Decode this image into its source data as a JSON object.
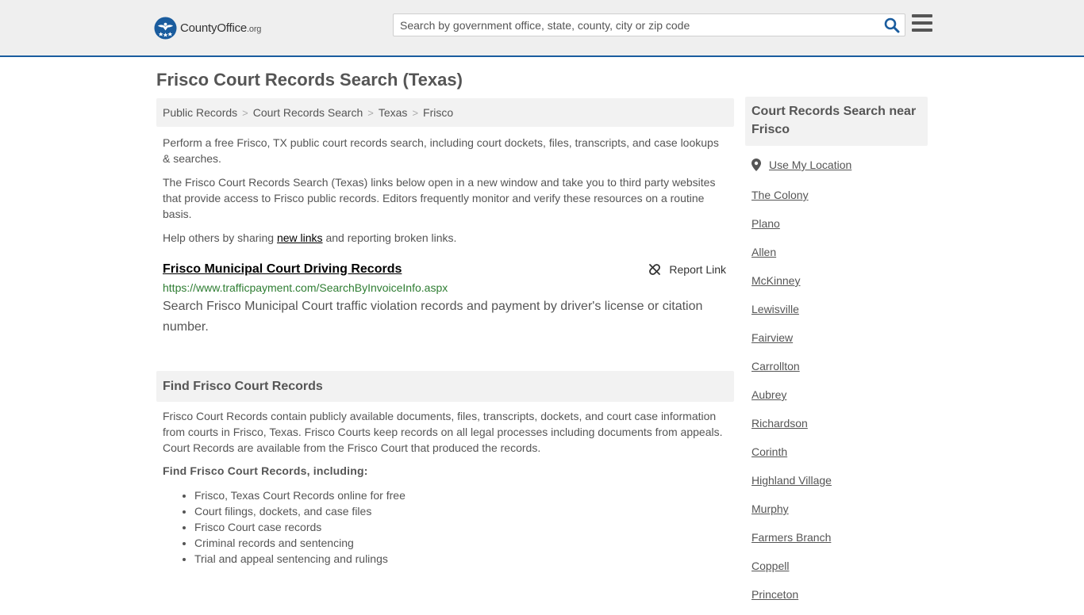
{
  "header": {
    "logo_brand": "CountyOffice",
    "logo_tld": ".org",
    "search_placeholder": "Search by government office, state, county, city or zip code",
    "search_icon": "search-icon",
    "menu_icon": "hamburger-menu-icon",
    "accent_color": "#1a5c9e"
  },
  "page": {
    "title": "Frisco Court Records Search (Texas)"
  },
  "breadcrumb": [
    {
      "label": "Public Records"
    },
    {
      "label": "Court Records Search"
    },
    {
      "label": "Texas"
    },
    {
      "label": "Frisco"
    }
  ],
  "intro": {
    "p1": "Perform a free Frisco, TX public court records search, including court dockets, files, transcripts, and case lookups & searches.",
    "p2": "The Frisco Court Records Search (Texas) links below open in a new window and take you to third party websites that provide access to Frisco public records. Editors frequently monitor and verify these resources on a routine basis.",
    "p3_before": "Help others by sharing ",
    "p3_link": "new links",
    "p3_after": " and reporting broken links."
  },
  "result": {
    "title": "Frisco Municipal Court Driving Records",
    "url": "https://www.trafficpayment.com/SearchByInvoiceInfo.aspx",
    "description": "Search Frisco Municipal Court traffic violation records and payment by driver's license or citation number.",
    "report_label": "Report Link",
    "report_icon": "broken-link-icon"
  },
  "find_section": {
    "heading": "Find Frisco Court Records",
    "body": "Frisco Court Records contain publicly available documents, files, transcripts, dockets, and court case information from courts in Frisco, Texas. Frisco Courts keep records on all legal processes including documents from appeals. Court Records are available from the Frisco Court that produced the records.",
    "subheading": "Find Frisco Court Records, including:",
    "items": [
      "Frisco, Texas Court Records online for free",
      "Court filings, dockets, and case files",
      "Frisco Court case records",
      "Criminal records and sentencing",
      "Trial and appeal sentencing and rulings"
    ]
  },
  "sidebar": {
    "heading": "Court Records Search near Frisco",
    "location_label": "Use My Location",
    "location_icon": "map-pin-icon",
    "cities": [
      "The Colony",
      "Plano",
      "Allen",
      "McKinney",
      "Lewisville",
      "Fairview",
      "Carrollton",
      "Aubrey",
      "Richardson",
      "Corinth",
      "Highland Village",
      "Murphy",
      "Farmers Branch",
      "Coppell",
      "Princeton"
    ]
  }
}
